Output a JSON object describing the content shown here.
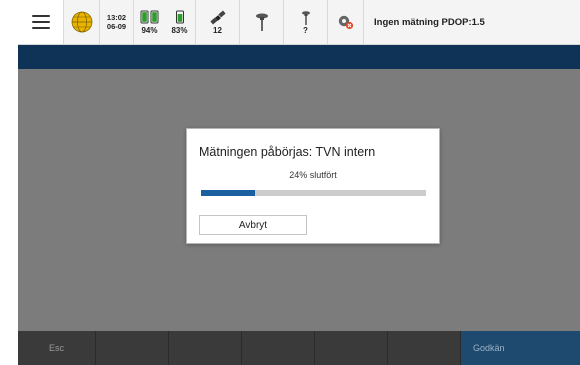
{
  "status_bar": {
    "time": "13:02",
    "date": "06-09",
    "battery_1": "94%",
    "battery_2": "83%",
    "satellites": "12",
    "antenna_2_label": "?",
    "status_text": "Ingen mätning  PDOP:1.5",
    "icons": [
      "menu-icon",
      "globe-icon",
      "battery-icon",
      "satellite-icon",
      "antenna-icon",
      "gear-icon"
    ]
  },
  "dialog": {
    "title": "Mätningen påbörjas: TVN intern",
    "progress_text": "24% slutfört",
    "progress_value": 0.24,
    "cancel_label": "Avbryt"
  },
  "bottom_bar": {
    "esc_label": "Esc",
    "ok_label": "Godkän"
  },
  "colors": {
    "accent_blue": "#1b5fa0",
    "header_band": "#0f3356",
    "content_bg": "#7c7c7c",
    "bottom_bar": "#3a3a3a",
    "ok_button": "#1d4a6e"
  }
}
